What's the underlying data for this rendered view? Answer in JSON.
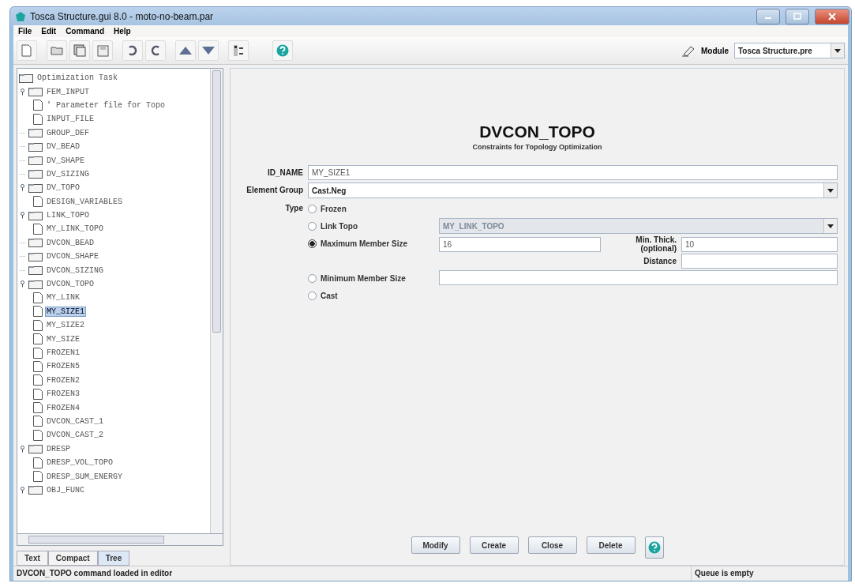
{
  "window": {
    "title": "Tosca Structure.gui 8.0 - moto-no-beam.par"
  },
  "menu": [
    "File",
    "Edit",
    "Command",
    "Help"
  ],
  "module": {
    "label": "Module",
    "value": "Tosca Structure.pre"
  },
  "tree": [
    {
      "label": "Optimization Task",
      "kind": "root",
      "children": [
        {
          "label": "FEM_INPUT",
          "kind": "folder",
          "expanded": true,
          "children": [
            {
              "label": "' Parameter file for Topo",
              "kind": "file",
              "selected": false
            },
            {
              "label": "INPUT_FILE",
              "kind": "file",
              "selected": false
            }
          ]
        },
        {
          "label": "GROUP_DEF",
          "kind": "folder",
          "expanded": false
        },
        {
          "label": "DV_BEAD",
          "kind": "folder",
          "expanded": false
        },
        {
          "label": "DV_SHAPE",
          "kind": "folder",
          "expanded": false
        },
        {
          "label": "DV_SIZING",
          "kind": "folder",
          "expanded": false
        },
        {
          "label": "DV_TOPO",
          "kind": "folder",
          "expanded": true,
          "children": [
            {
              "label": "DESIGN_VARIABLES",
              "kind": "file",
              "selected": false
            }
          ]
        },
        {
          "label": "LINK_TOPO",
          "kind": "folder",
          "expanded": true,
          "children": [
            {
              "label": "MY_LINK_TOPO",
              "kind": "file",
              "selected": false
            }
          ]
        },
        {
          "label": "DVCON_BEAD",
          "kind": "folder",
          "expanded": false
        },
        {
          "label": "DVCON_SHAPE",
          "kind": "folder",
          "expanded": false
        },
        {
          "label": "DVCON_SIZING",
          "kind": "folder",
          "expanded": false
        },
        {
          "label": "DVCON_TOPO",
          "kind": "folder",
          "expanded": true,
          "children": [
            {
              "label": "MY_LINK",
              "kind": "file",
              "selected": false
            },
            {
              "label": "MY_SIZE1",
              "kind": "file",
              "selected": true
            },
            {
              "label": "MY_SIZE2",
              "kind": "file",
              "selected": false
            },
            {
              "label": "MY_SIZE",
              "kind": "file",
              "selected": false
            },
            {
              "label": "FROZEN1",
              "kind": "file",
              "selected": false
            },
            {
              "label": "FROZEN5",
              "kind": "file",
              "selected": false
            },
            {
              "label": "FROZEN2",
              "kind": "file",
              "selected": false
            },
            {
              "label": "FROZEN3",
              "kind": "file",
              "selected": false
            },
            {
              "label": "FROZEN4",
              "kind": "file",
              "selected": false
            },
            {
              "label": "DVCON_CAST_1",
              "kind": "file",
              "selected": false
            },
            {
              "label": "DVCON_CAST_2",
              "kind": "file",
              "selected": false
            }
          ]
        },
        {
          "label": "DRESP",
          "kind": "folder",
          "expanded": true,
          "children": [
            {
              "label": "DRESP_VOL_TOPO",
              "kind": "file",
              "selected": false
            },
            {
              "label": "DRESP_SUM_ENERGY",
              "kind": "file",
              "selected": false
            }
          ]
        },
        {
          "label": "OBJ_FUNC",
          "kind": "folder",
          "expanded": true
        }
      ]
    }
  ],
  "view_tabs": [
    {
      "label": "Text",
      "selected": false
    },
    {
      "label": "Compact",
      "selected": false
    },
    {
      "label": "Tree",
      "selected": true
    }
  ],
  "editor": {
    "title": "DVCON_TOPO",
    "subtitle": "Constraints for Topology Optimization",
    "id_name": {
      "label": "ID_NAME",
      "value": "MY_SIZE1"
    },
    "element_group": {
      "label": "Element Group",
      "value": "Cast.Neg"
    },
    "type_label": "Type",
    "type_options": [
      {
        "label": "Frozen",
        "selected": false,
        "kind": "plain"
      },
      {
        "label": "Link Topo",
        "selected": false,
        "kind": "combo",
        "value": "MY_LINK_TOPO",
        "disabled": true
      },
      {
        "label": "Maximum Member Size",
        "selected": true,
        "kind": "size",
        "value": "16",
        "extra": [
          {
            "label": "Min. Thick. (optional)",
            "value": "10"
          },
          {
            "label": "Distance"
          }
        ]
      },
      {
        "label": "Minimum Member Size",
        "selected": false,
        "kind": "text"
      },
      {
        "label": "Cast",
        "selected": false,
        "kind": "plain"
      }
    ],
    "buttons": [
      "Modify",
      "Create",
      "Close",
      "Delete"
    ]
  },
  "status_bar": {
    "message": "DVCON_TOPO command loaded in editor",
    "queue": "Queue is empty"
  }
}
